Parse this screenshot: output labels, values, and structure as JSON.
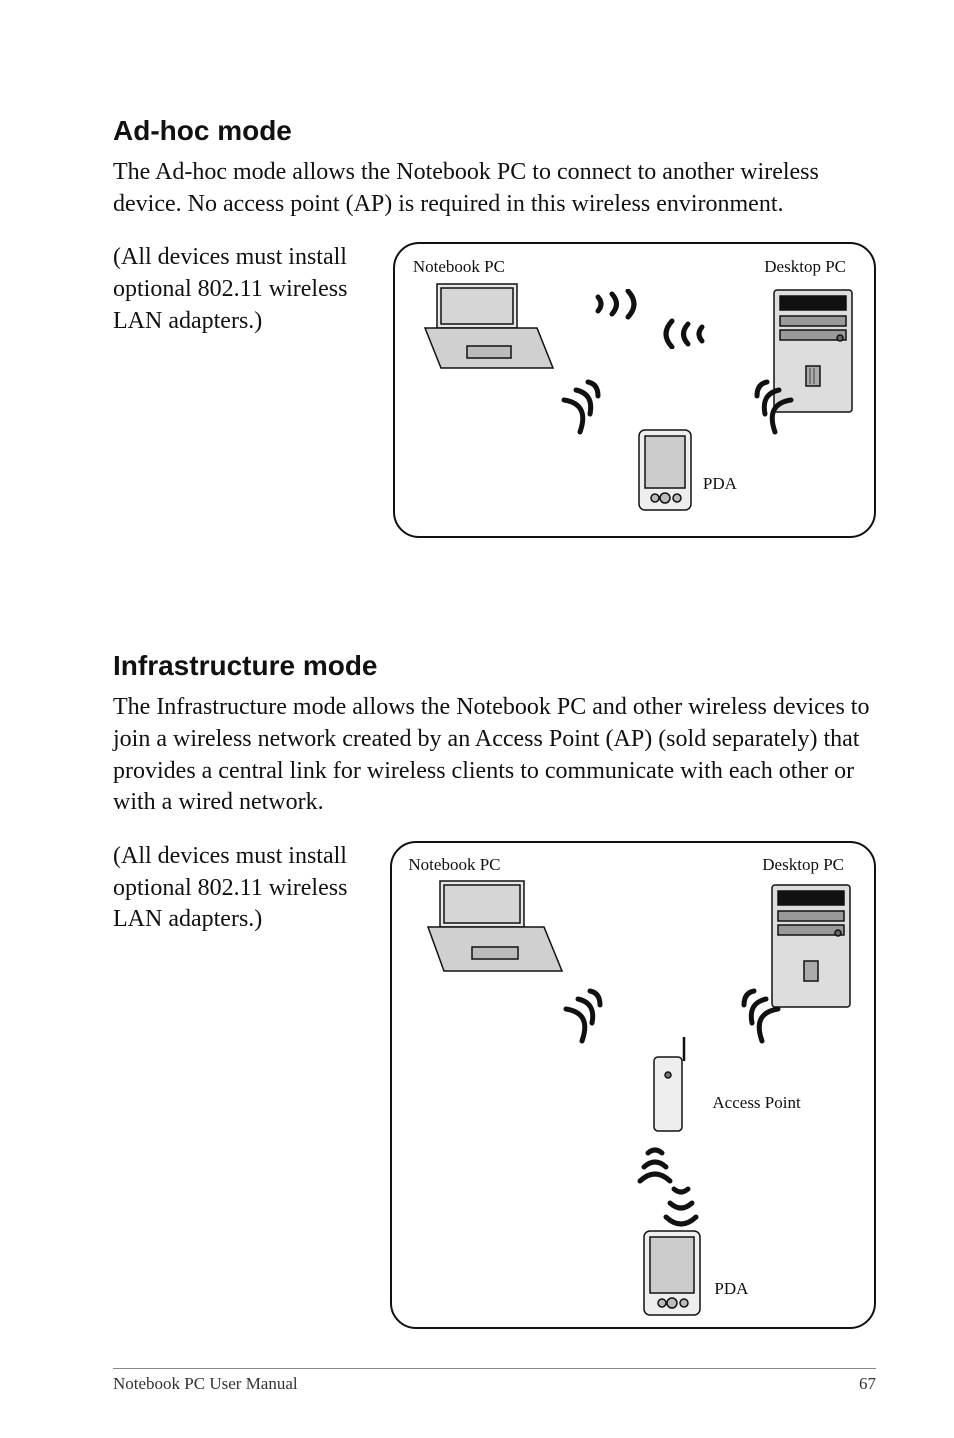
{
  "section1": {
    "heading": "Ad-hoc mode",
    "desc": "The Ad-hoc mode allows the Notebook PC to connect to another wireless device. No access point (AP) is required in this wireless environment.",
    "side": "(All devices must install optional 802.11 wireless LAN adapters.)",
    "labels": {
      "notebook": "Notebook PC",
      "desktop": "Desktop PC",
      "pda": "PDA"
    }
  },
  "section2": {
    "heading": "Infrastructure mode",
    "desc": "The Infrastructure mode allows the Notebook PC and other wireless devices to join a wireless network created by an Access Point (AP) (sold separately) that provides a central link for wireless clients to communicate with each other or with a wired network.",
    "side": "(All devices must install optional 802.11 wireless LAN adapters.)",
    "labels": {
      "notebook": "Notebook PC",
      "desktop": "Desktop PC",
      "pda": "PDA",
      "ap": "Access Point"
    }
  },
  "footer": {
    "manual": "Notebook PC User Manual",
    "page": "67"
  }
}
